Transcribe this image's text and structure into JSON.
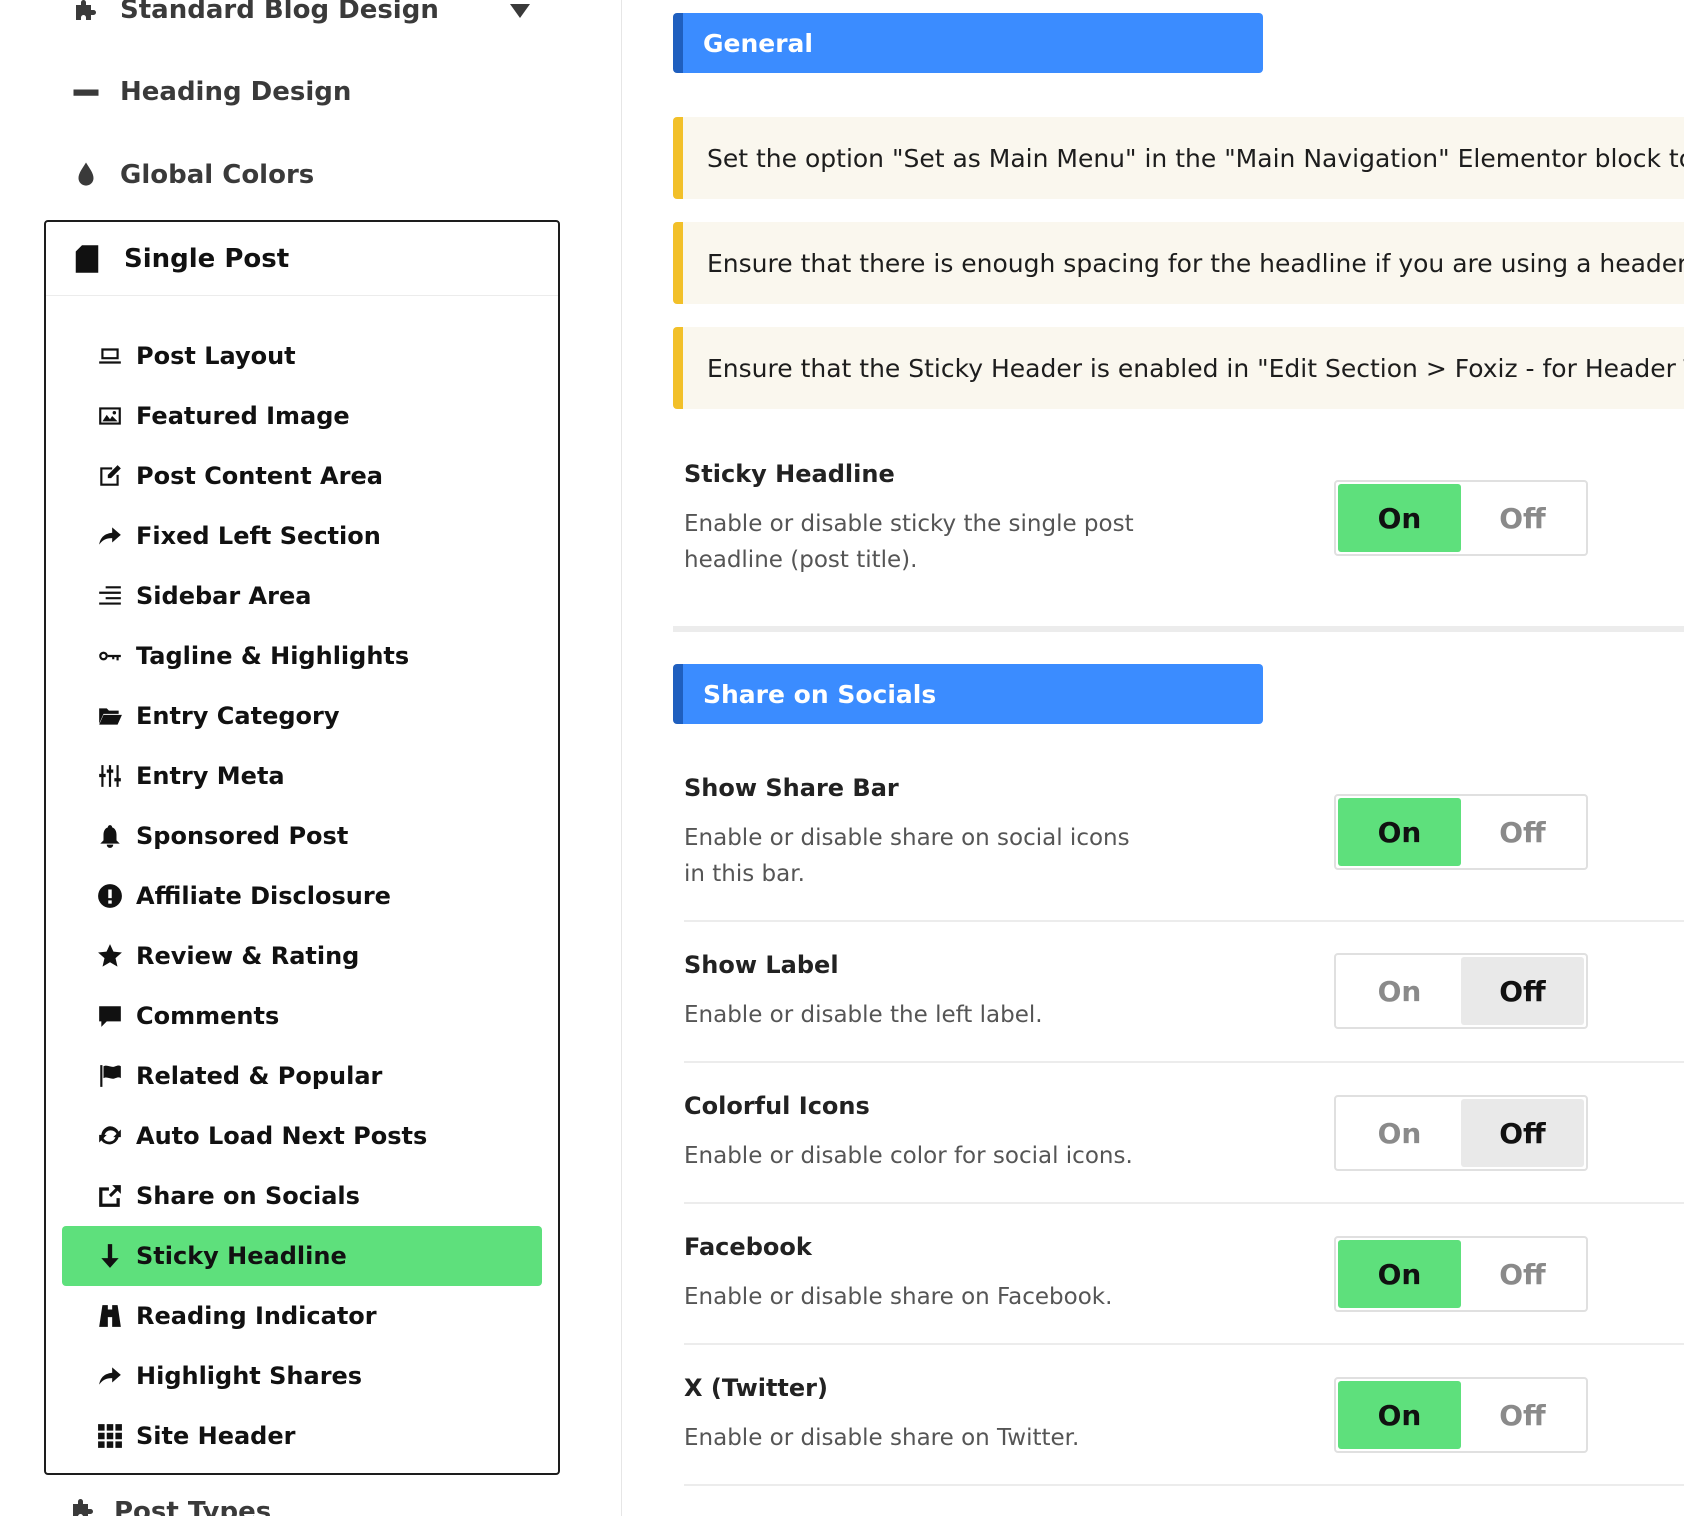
{
  "sidebar": {
    "top_items": [
      {
        "label": "Standard Blog Design",
        "icon": "puzzle-icon"
      },
      {
        "label": "Heading Design",
        "icon": "minus-icon"
      },
      {
        "label": "Global Colors",
        "icon": "drop-icon"
      }
    ],
    "group": {
      "title": "Single Post",
      "icon": "document-icon",
      "items": [
        {
          "label": "Post Layout",
          "icon": "laptop-icon"
        },
        {
          "label": "Featured Image",
          "icon": "image-icon"
        },
        {
          "label": "Post Content Area",
          "icon": "edit-icon"
        },
        {
          "label": "Fixed Left Section",
          "icon": "share-arrow-icon"
        },
        {
          "label": "Sidebar Area",
          "icon": "align-right-icon"
        },
        {
          "label": "Tagline & Highlights",
          "icon": "key-icon"
        },
        {
          "label": "Entry Category",
          "icon": "folder-icon"
        },
        {
          "label": "Entry Meta",
          "icon": "sliders-icon"
        },
        {
          "label": "Sponsored Post",
          "icon": "bell-icon"
        },
        {
          "label": "Affiliate Disclosure",
          "icon": "alert-icon"
        },
        {
          "label": "Review & Rating",
          "icon": "star-icon"
        },
        {
          "label": "Comments",
          "icon": "comment-icon"
        },
        {
          "label": "Related & Popular",
          "icon": "flag-icon"
        },
        {
          "label": "Auto Load Next Posts",
          "icon": "refresh-icon"
        },
        {
          "label": "Share on Socials",
          "icon": "external-share-icon"
        },
        {
          "label": "Sticky Headline",
          "icon": "arrow-down-icon",
          "active": true
        },
        {
          "label": "Reading Indicator",
          "icon": "binoculars-icon"
        },
        {
          "label": "Highlight Shares",
          "icon": "share-arrow-icon"
        },
        {
          "label": "Site Header",
          "icon": "grid-icon"
        }
      ]
    },
    "bottom_item": {
      "label": "Post Types",
      "icon": "puzzle-icon"
    }
  },
  "main": {
    "general": {
      "title": "General",
      "notices": [
        "Set the option \"Set as Main Menu\" in the \"Main Navigation\" Elementor block to \"Y",
        "Ensure that there is enough spacing for the headline if you are using a header ter",
        "Ensure that the Sticky Header is enabled in \"Edit Section > Foxiz - for Header Ter"
      ],
      "sticky_headline": {
        "title": "Sticky Headline",
        "desc": "Enable or disable sticky the single post headline (post title).",
        "on_label": "On",
        "off_label": "Off",
        "value": "on"
      }
    },
    "share": {
      "title": "Share on Socials",
      "options": [
        {
          "title": "Show Share Bar",
          "desc": "Enable or disable share on social icons in this bar.",
          "on_label": "On",
          "off_label": "Off",
          "value": "on"
        },
        {
          "title": "Show Label",
          "desc": "Enable or disable the left label.",
          "on_label": "On",
          "off_label": "Off",
          "value": "off"
        },
        {
          "title": "Colorful Icons",
          "desc": "Enable or disable color for social icons.",
          "on_label": "On",
          "off_label": "Off",
          "value": "off"
        },
        {
          "title": "Facebook",
          "desc": "Enable or disable share on Facebook.",
          "on_label": "On",
          "off_label": "Off",
          "value": "on"
        },
        {
          "title": "X (Twitter)",
          "desc": "Enable or disable share on Twitter.",
          "on_label": "On",
          "off_label": "Off",
          "value": "on"
        }
      ]
    }
  },
  "colors": {
    "accent_green": "#5ee07c",
    "header_blue": "#3b8cff",
    "notice_yellow": "#f2c029"
  }
}
